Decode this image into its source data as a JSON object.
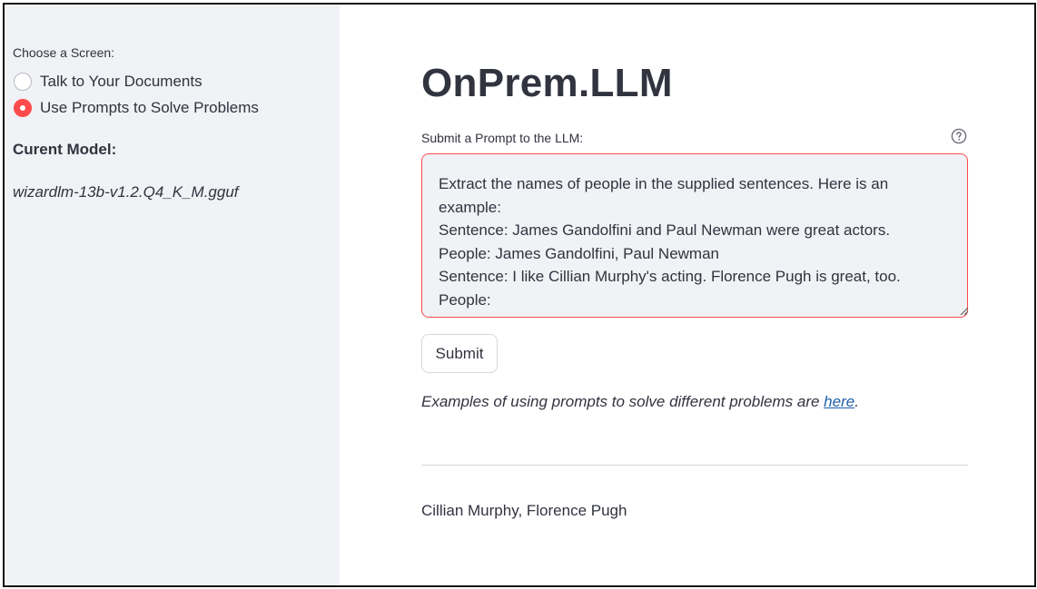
{
  "sidebar": {
    "radio_group_label": "Choose a Screen:",
    "options": [
      {
        "label": "Talk to Your Documents",
        "selected": false
      },
      {
        "label": "Use Prompts to Solve Problems",
        "selected": true
      }
    ],
    "model_heading": "Curent Model:",
    "model_name": "wizardlm-13b-v1.2.Q4_K_M.gguf"
  },
  "main": {
    "title": "OnPrem.LLM",
    "prompt_label": "Submit a Prompt to the LLM:",
    "help_icon": "question-circle-icon",
    "prompt_value": "Extract the names of people in the supplied sentences. Here is an example:\nSentence: James Gandolfini and Paul Newman were great actors.\nPeople: James Gandolfini, Paul Newman\nSentence: I like Cillian Murphy's acting. Florence Pugh is great, too.\nPeople:",
    "submit_label": "Submit",
    "examples_prefix": "Examples of using prompts to solve different problems are ",
    "examples_link": "here",
    "examples_suffix": ".",
    "result": "Cillian Murphy, Florence Pugh"
  },
  "colors": {
    "accent": "#ff4b4b",
    "sidebar_bg": "#f0f2f6",
    "text": "#31333f",
    "link": "#1f5fa8"
  }
}
